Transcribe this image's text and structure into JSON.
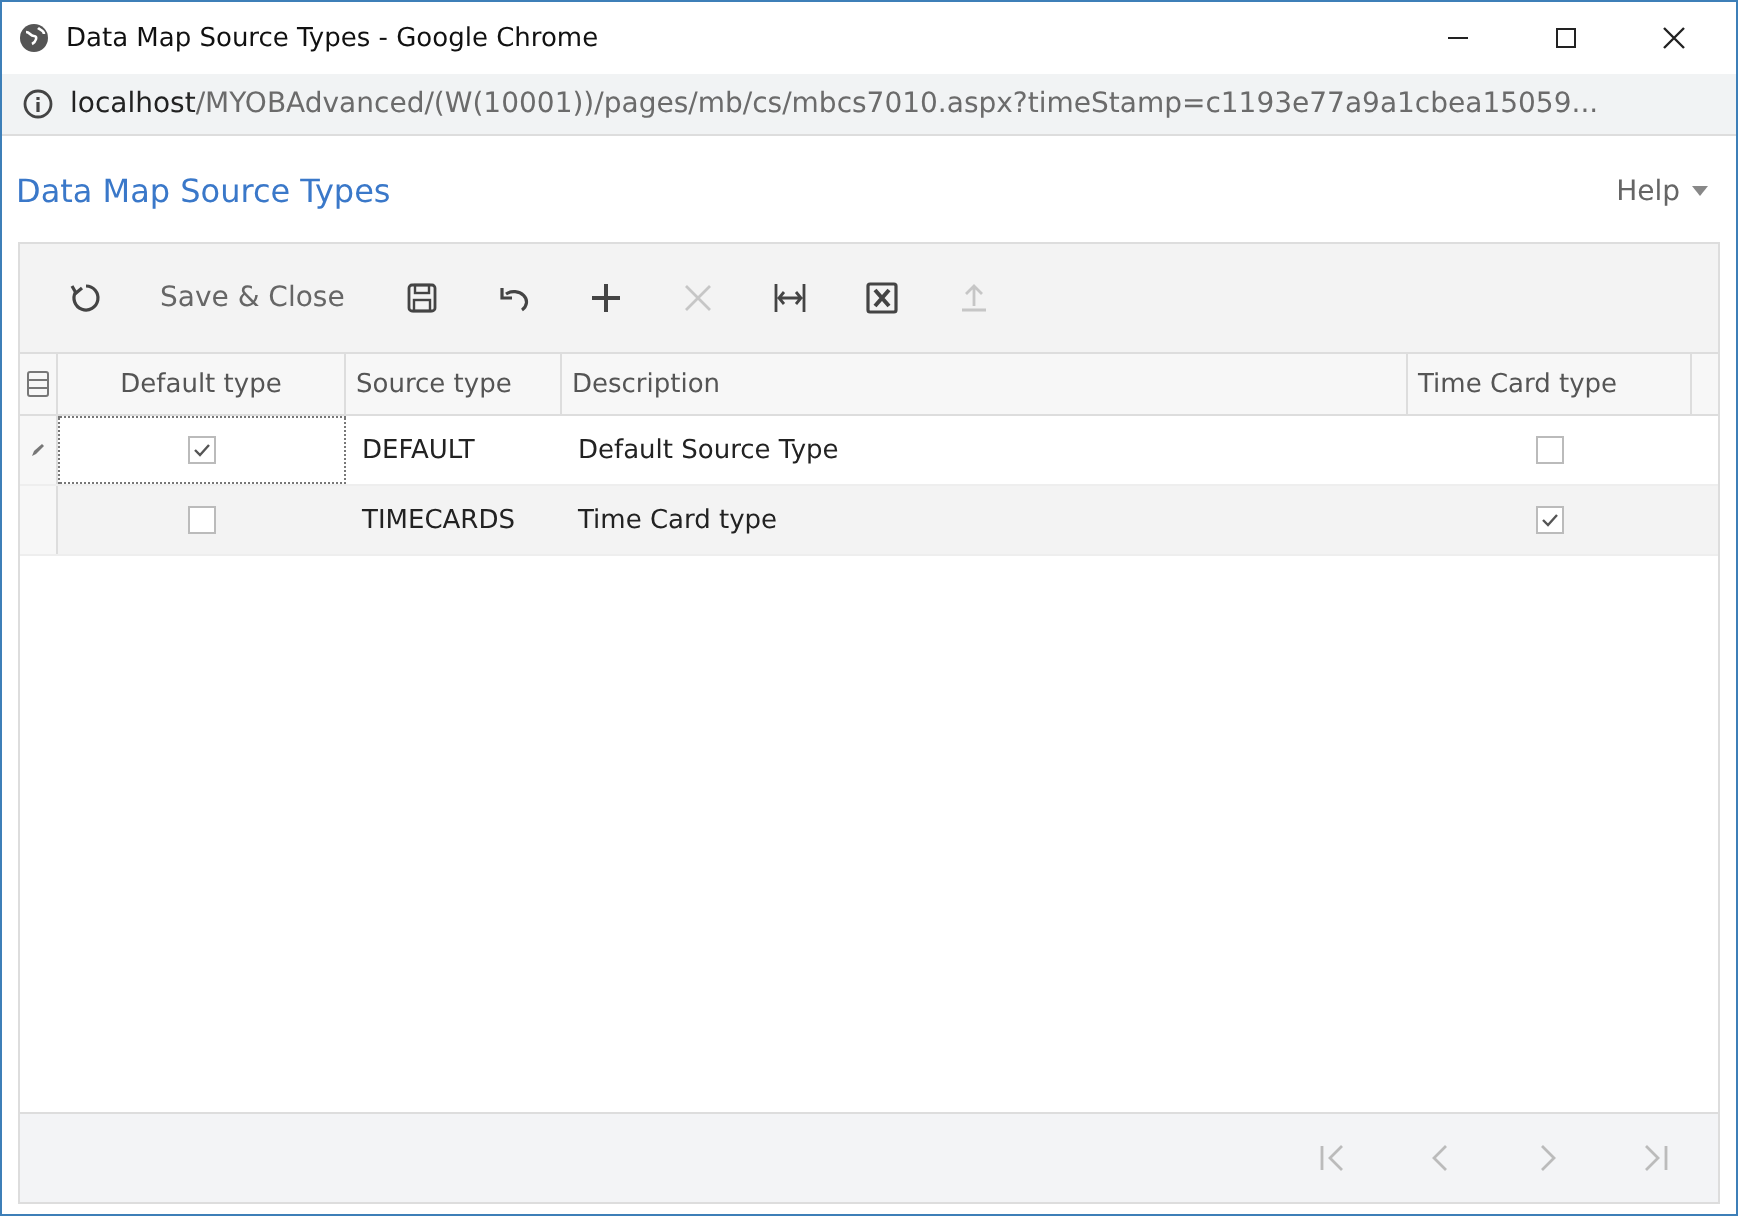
{
  "window": {
    "title": "Data Map Source Types - Google Chrome"
  },
  "address_bar": {
    "host": "localhost",
    "path": "/MYOBAdvanced/(W(10001))/pages/mb/cs/mbcs7010.aspx?timeStamp=c1193e77a9a1cbea15059..."
  },
  "page": {
    "title": "Data Map Source Types",
    "help": "Help"
  },
  "toolbar": [
    {
      "kind": "refresh",
      "disabled": false
    },
    {
      "kind": "text",
      "label": "Save & Close"
    },
    {
      "kind": "save",
      "disabled": false
    },
    {
      "kind": "undo",
      "disabled": false
    },
    {
      "kind": "add",
      "disabled": false
    },
    {
      "kind": "delete",
      "disabled": true
    },
    {
      "kind": "fit",
      "disabled": false
    },
    {
      "kind": "excel",
      "disabled": false
    },
    {
      "kind": "upload",
      "disabled": true
    }
  ],
  "table": {
    "columns": [
      "Default type",
      "Source type",
      "Description",
      "Time Card type"
    ],
    "rows": [
      {
        "default_type": true,
        "source_type": "DEFAULT",
        "description": "Default Source Type",
        "time_card_type": false,
        "editing": true
      },
      {
        "default_type": false,
        "source_type": "TIMECARDS",
        "description": "Time Card type",
        "time_card_type": true,
        "editing": false
      }
    ]
  },
  "pager": [
    {
      "kind": "first",
      "disabled": true
    },
    {
      "kind": "prev",
      "disabled": true
    },
    {
      "kind": "next",
      "disabled": true
    },
    {
      "kind": "last",
      "disabled": true
    }
  ]
}
